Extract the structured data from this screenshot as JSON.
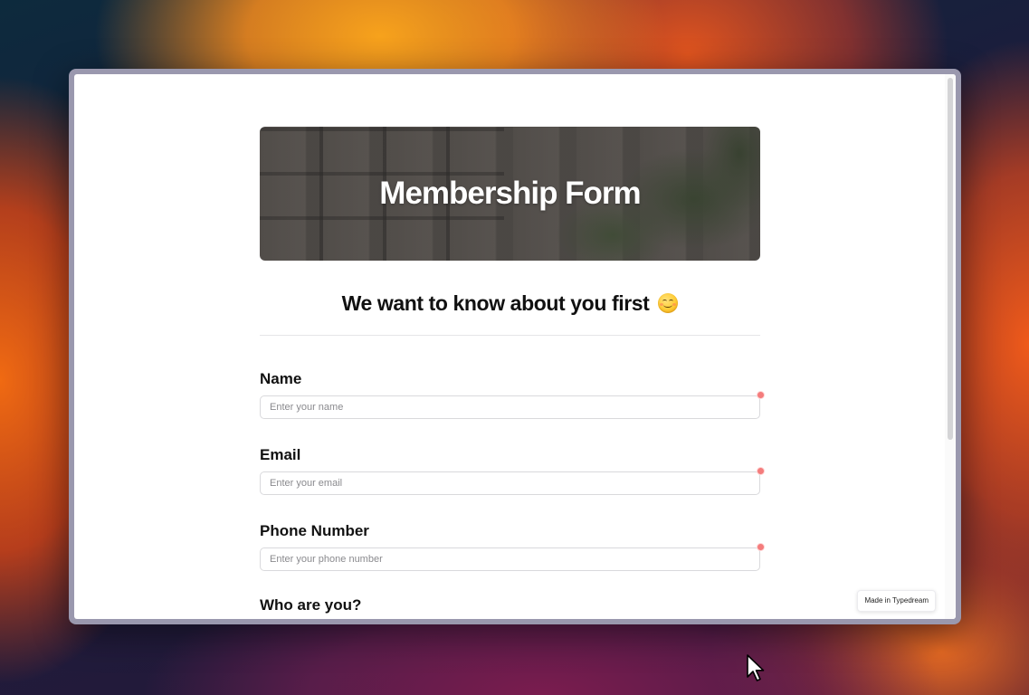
{
  "form": {
    "banner_title": "Membership Form",
    "subtitle": "We want to know about you first",
    "subtitle_emoji": "smiling-face-icon",
    "fields": [
      {
        "label": "Name",
        "placeholder": "Enter your name",
        "required": true
      },
      {
        "label": "Email",
        "placeholder": "Enter your email",
        "required": true
      },
      {
        "label": "Phone Number",
        "placeholder": "Enter your phone number",
        "required": true
      }
    ],
    "next_question": "Who are you?"
  },
  "badge": {
    "label": "Made in Typedream"
  },
  "colors": {
    "required_indicator": "#f47c7c",
    "text": "#111111",
    "input_border": "#d9d9dc"
  },
  "icons": {
    "cursor": "pointer-arrow-icon"
  }
}
